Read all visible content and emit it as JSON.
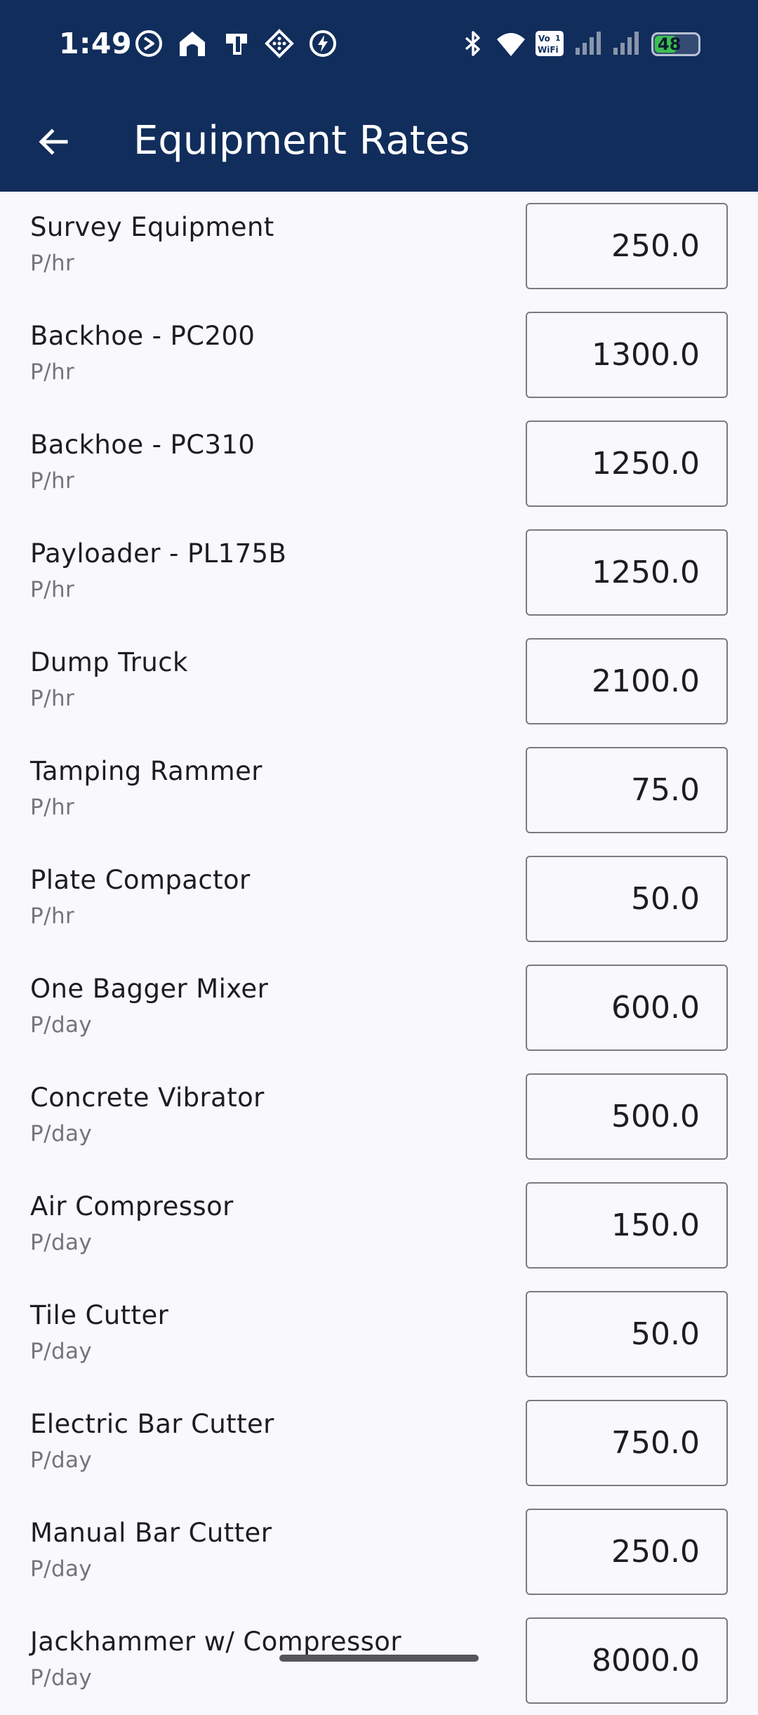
{
  "status_bar": {
    "time": "1:49",
    "battery_percent": "48",
    "battery_level": 0.48,
    "network_badge_top": "Vo",
    "network_badge_bottom": "WiFi",
    "network_badge_num": "1",
    "icons": [
      "do-not-disturb-icon",
      "home-icon",
      "payment-app-icon",
      "diamond-grid-icon",
      "bolt-icon",
      "bluetooth-icon",
      "wifi-icon",
      "vowifi-icon",
      "signal-icon",
      "signal-icon",
      "battery-icon"
    ]
  },
  "header": {
    "title": "Equipment Rates",
    "back_icon": "arrow-left-icon"
  },
  "equipment": [
    {
      "name": "Survey Equipment",
      "unit": "P/hr",
      "rate": "250.0"
    },
    {
      "name": "Backhoe - PC200",
      "unit": "P/hr",
      "rate": "1300.0"
    },
    {
      "name": "Backhoe - PC310",
      "unit": "P/hr",
      "rate": "1250.0"
    },
    {
      "name": "Payloader - PL175B",
      "unit": "P/hr",
      "rate": "1250.0"
    },
    {
      "name": "Dump Truck",
      "unit": "P/hr",
      "rate": "2100.0"
    },
    {
      "name": "Tamping Rammer",
      "unit": "P/hr",
      "rate": "75.0"
    },
    {
      "name": "Plate Compactor",
      "unit": "P/hr",
      "rate": "50.0"
    },
    {
      "name": "One Bagger Mixer",
      "unit": "P/day",
      "rate": "600.0"
    },
    {
      "name": "Concrete Vibrator",
      "unit": "P/day",
      "rate": "500.0"
    },
    {
      "name": "Air Compressor",
      "unit": "P/day",
      "rate": "150.0"
    },
    {
      "name": "Tile Cutter",
      "unit": "P/day",
      "rate": "50.0"
    },
    {
      "name": "Electric Bar Cutter",
      "unit": "P/day",
      "rate": "750.0"
    },
    {
      "name": "Manual Bar Cutter",
      "unit": "P/day",
      "rate": "250.0"
    },
    {
      "name": "Jackhammer w/ Compressor",
      "unit": "P/day",
      "rate": "8000.0"
    }
  ],
  "colors": {
    "appbar": "#112d5c",
    "background": "#f8f8fd",
    "battery": "#3cc04f"
  }
}
